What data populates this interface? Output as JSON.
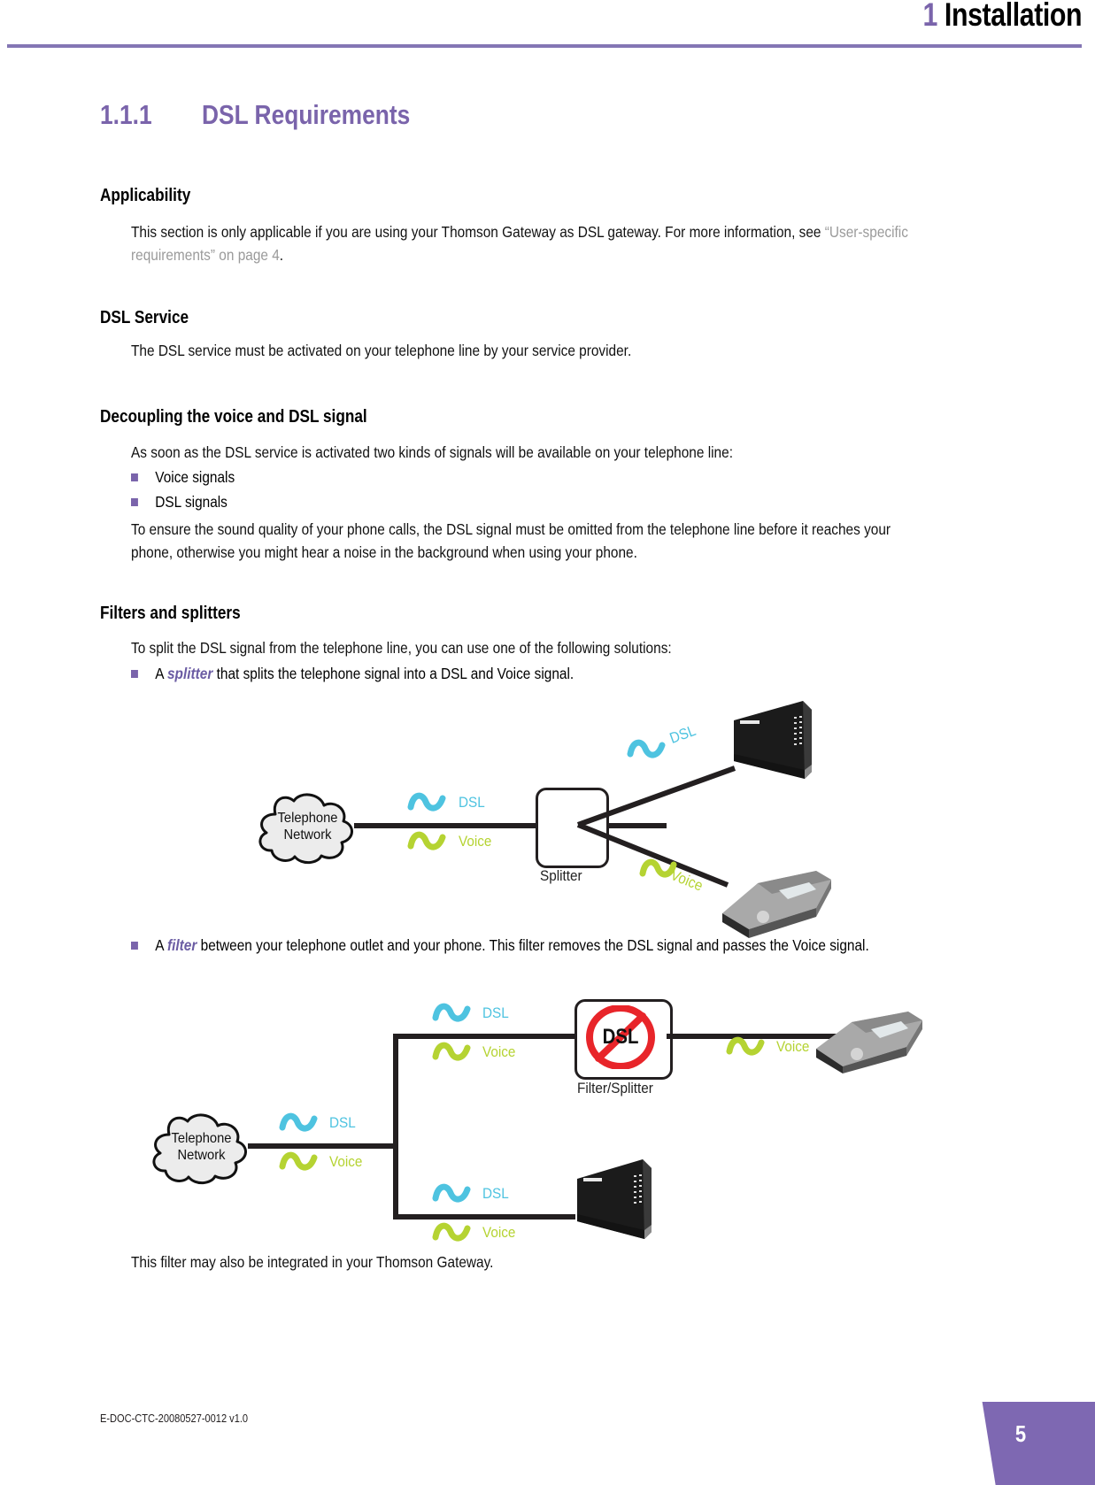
{
  "header": {
    "chapter_number": "1",
    "chapter_title": "Installation"
  },
  "section": {
    "number": "1.1.1",
    "title": "DSL Requirements"
  },
  "subsections": [
    {
      "heading": "Applicability",
      "paragraph_before_xref": "This section is only applicable if you are using your Thomson Gateway as DSL gateway. For more information, see ",
      "xref": "“User-specific requirements” on page 4",
      "paragraph_after_xref": "."
    },
    {
      "heading": "DSL Service",
      "paragraph": "The DSL service must be activated on your telephone line by your service provider."
    },
    {
      "heading": "Decoupling the voice and DSL signal",
      "paragraph": "As soon as the DSL service is activated two kinds of signals will be available on your telephone line:",
      "bullets": [
        "Voice signals",
        "DSL signals"
      ],
      "paragraph2": "To ensure the sound quality of your phone calls, the DSL signal must be omitted from the telephone line before it reaches your phone, otherwise you might hear a noise in the background when using your phone."
    },
    {
      "heading": "Filters and splitters",
      "paragraph": "To split the DSL signal from the telephone line, you can use one of the following solutions:",
      "bullet1_pre": "A ",
      "bullet1_em": "splitter",
      "bullet1_post": " that splits the telephone signal into a DSL and Voice signal.",
      "bullet2_pre": "A ",
      "bullet2_em": "filter",
      "bullet2_post": " between your telephone outlet and your phone. This filter removes the DSL signal and passes the Voice signal.",
      "closing": "This filter may also be integrated in your Thomson Gateway."
    }
  ],
  "diagram1": {
    "cloud_line1": "Telephone",
    "cloud_line2": "Network",
    "trunk_dsl": "DSL",
    "trunk_voice": "Voice",
    "splitter_label": "Splitter",
    "branch_dsl": "DSL",
    "branch_voice": "Voice"
  },
  "diagram2": {
    "cloud_line1": "Telephone",
    "cloud_line2": "Network",
    "trunk_dsl": "DSL",
    "trunk_voice": "Voice",
    "upper_dsl": "DSL",
    "upper_voice": "Voice",
    "filter_badge": "DSL",
    "filter_label": "Filter/Splitter",
    "out_voice": "Voice",
    "lower_dsl": "DSL",
    "lower_voice": "Voice"
  },
  "footer": {
    "doc_code": "E-DOC-CTC-20080527-0012 v1.0",
    "page_number": "5"
  },
  "colors": {
    "accent_purple": "#7a64ab",
    "rule_purple": "#8476b4",
    "dsl_cyan": "#4ec3e0",
    "voice_green": "#b5d332",
    "forbidden_red": "#e8252a",
    "ink": "#231f20"
  }
}
